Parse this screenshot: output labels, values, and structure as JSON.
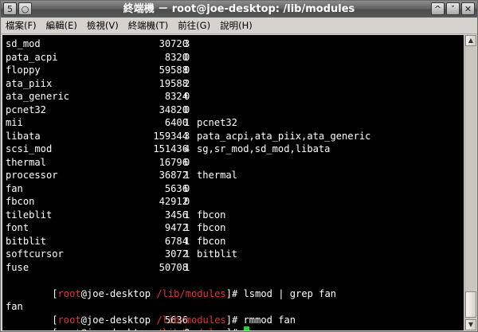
{
  "window": {
    "title": "終端機 － root@joe-desktop: /lib/modules",
    "buttons": {
      "menu": "5",
      "sticky": "○",
      "up": "^",
      "down": "˅",
      "close": "✕"
    }
  },
  "menu": [
    "檔案(F)",
    "編輯(E)",
    "檢視(V)",
    "終端機(T)",
    "前往(G)",
    "說明(H)"
  ],
  "modules": [
    {
      "name": "sd_mod",
      "size": "30720",
      "used": "3",
      "by": ""
    },
    {
      "name": "pata_acpi",
      "size": "8320",
      "used": "0",
      "by": ""
    },
    {
      "name": "floppy",
      "size": "59588",
      "used": "0",
      "by": ""
    },
    {
      "name": "ata_piix",
      "size": "19588",
      "used": "2",
      "by": ""
    },
    {
      "name": "ata_generic",
      "size": "8324",
      "used": "0",
      "by": ""
    },
    {
      "name": "pcnet32",
      "size": "34820",
      "used": "0",
      "by": ""
    },
    {
      "name": "mii",
      "size": "6400",
      "used": "1",
      "by": "pcnet32"
    },
    {
      "name": "libata",
      "size": "159344",
      "used": "3",
      "by": "pata_acpi,ata_piix,ata_generic"
    },
    {
      "name": "scsi_mod",
      "size": "151436",
      "used": "4",
      "by": "sg,sr_mod,sd_mod,libata"
    },
    {
      "name": "thermal",
      "size": "16796",
      "used": "0",
      "by": ""
    },
    {
      "name": "processor",
      "size": "36872",
      "used": "1",
      "by": "thermal"
    },
    {
      "name": "fan",
      "size": "5636",
      "used": "0",
      "by": ""
    },
    {
      "name": "fbcon",
      "size": "42912",
      "used": "0",
      "by": ""
    },
    {
      "name": "tileblit",
      "size": "3456",
      "used": "1",
      "by": "fbcon"
    },
    {
      "name": "font",
      "size": "9472",
      "used": "1",
      "by": "fbcon"
    },
    {
      "name": "bitblit",
      "size": "6784",
      "used": "1",
      "by": "fbcon"
    },
    {
      "name": "softcursor",
      "size": "3072",
      "used": "1",
      "by": "bitblit"
    },
    {
      "name": "fuse",
      "size": "50708",
      "used": "1",
      "by": ""
    }
  ],
  "prompt": {
    "open": "[",
    "user": "root",
    "host": "@joe-desktop",
    "path": "/lib/modules",
    "close": "]# "
  },
  "commands": [
    "lsmod | grep fan",
    "rmmod fan"
  ],
  "grep_result": {
    "name": "fan",
    "size": "5636",
    "used": "0"
  },
  "colors": {
    "prompt_red": "#e53232",
    "cursor": "#29d22c",
    "background": "#000000",
    "text": "#ffffff"
  }
}
